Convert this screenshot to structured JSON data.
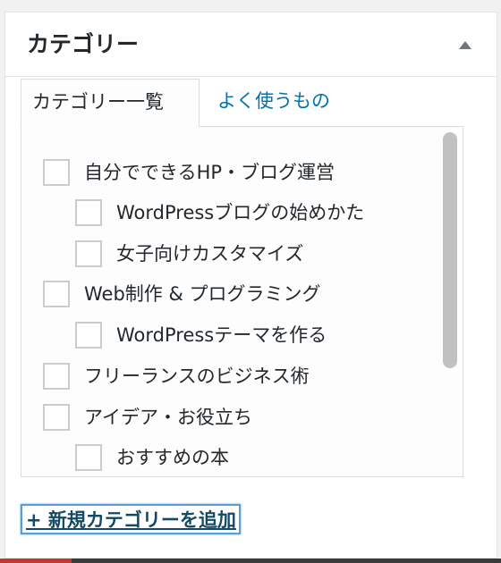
{
  "postbox": {
    "title": "カテゴリー"
  },
  "tabs": [
    {
      "label": "カテゴリー一覧",
      "active": true
    },
    {
      "label": "よく使うもの",
      "active": false
    }
  ],
  "categories": [
    {
      "label": "自分でできるHP・ブログ運営",
      "level": 0,
      "checked": false
    },
    {
      "label": "WordPressブログの始めかた",
      "level": 1,
      "checked": false
    },
    {
      "label": "女子向けカスタマイズ",
      "level": 1,
      "checked": false
    },
    {
      "label": "Web制作 & プログラミング",
      "level": 0,
      "checked": false
    },
    {
      "label": "WordPressテーマを作る",
      "level": 1,
      "checked": false
    },
    {
      "label": "フリーランスのビジネス術",
      "level": 0,
      "checked": false
    },
    {
      "label": "アイデア・お役立ち",
      "level": 0,
      "checked": false
    },
    {
      "label": "おすすめの本",
      "level": 1,
      "checked": false
    }
  ],
  "add_link": {
    "label": "+ 新規カテゴリーを追加"
  },
  "icons": {
    "toggle": "triangle-up-icon"
  },
  "colors": {
    "link": "#0073aa",
    "link_focus": "#124964",
    "focus_ring": "#5b9dd9",
    "border": "#dddddd",
    "text": "#23282d"
  }
}
